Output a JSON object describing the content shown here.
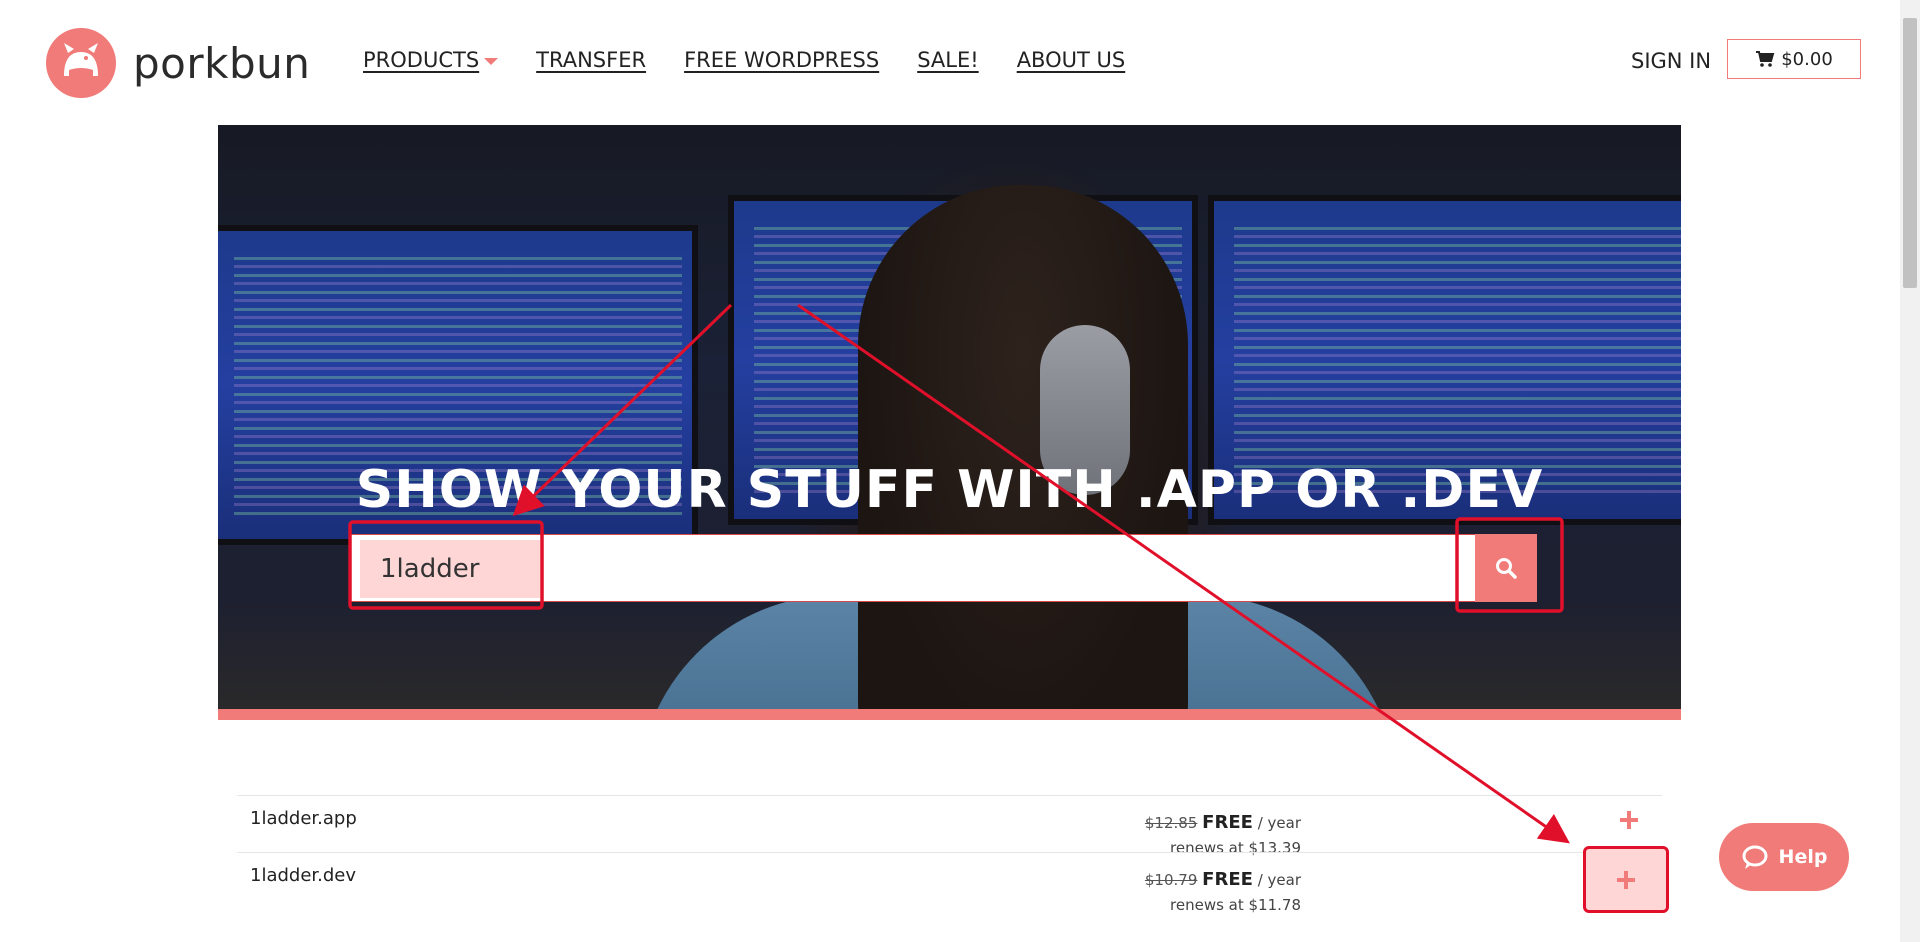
{
  "brand": {
    "name": "porkbun"
  },
  "nav": {
    "items": [
      {
        "label": "PRODUCTS",
        "has_dropdown": true
      },
      {
        "label": "TRANSFER"
      },
      {
        "label": "FREE WORDPRESS"
      },
      {
        "label": "SALE!"
      },
      {
        "label": "ABOUT US"
      }
    ]
  },
  "account": {
    "signin_label": "SIGN IN",
    "cart_total": "$0.00"
  },
  "hero": {
    "title": "SHOW YOUR STUFF WITH .APP OR .DEV",
    "search_value": "1ladder"
  },
  "results": [
    {
      "domain": "1ladder.app",
      "old_price": "$12.85",
      "price": "FREE",
      "period": "/ year",
      "renews": "renews at $13.39"
    },
    {
      "domain": "1ladder.dev",
      "old_price": "$10.79",
      "price": "FREE",
      "period": "/ year",
      "renews": "renews at $11.78"
    }
  ],
  "help": {
    "label": "Help"
  },
  "colors": {
    "accent": "#f07b78",
    "annotation": "#e0102a",
    "highlight": "#ffd6d6"
  },
  "icons": {
    "logo": "pig-icon",
    "cart": "cart-icon",
    "search": "search-icon",
    "add": "plus-icon",
    "help": "chat-icon"
  }
}
